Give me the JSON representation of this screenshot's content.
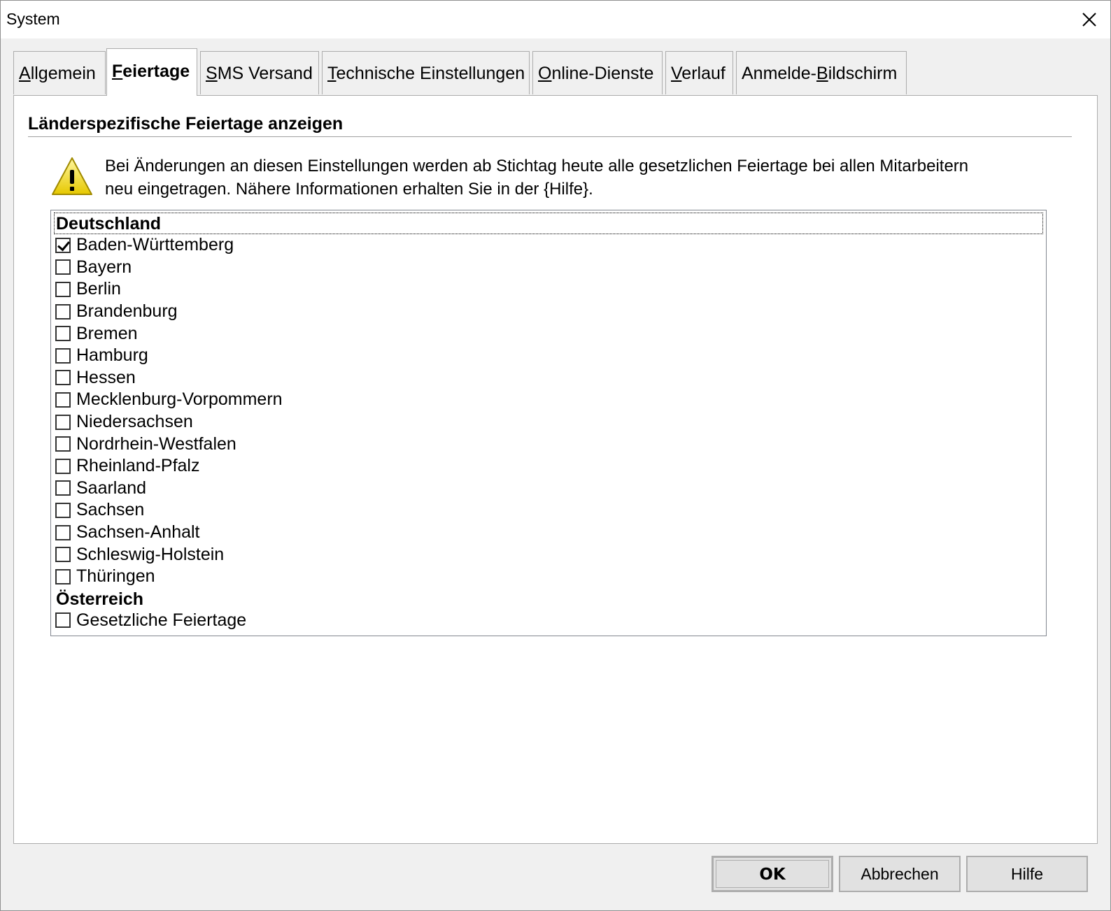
{
  "window": {
    "title": "System"
  },
  "tabs": [
    {
      "label": "Allgemein",
      "accel": "A",
      "rest": "llgemein",
      "active": false
    },
    {
      "label": "Feiertage",
      "accel": "F",
      "rest": "eiertage",
      "active": true
    },
    {
      "label": "SMS Versand",
      "accel": "S",
      "rest": "MS Versand",
      "active": false
    },
    {
      "label": "Technische Einstellungen",
      "accel": "T",
      "rest": "echnische Einstellungen",
      "active": false
    },
    {
      "label": "Online-Dienste",
      "accel": "O",
      "rest": "nline-Dienste",
      "active": false
    },
    {
      "label": "Verlauf",
      "accel": "V",
      "rest": "erlauf",
      "active": false
    },
    {
      "label": "Anmelde-Bildschirm",
      "pre": "Anmelde-",
      "accel": "B",
      "rest": "ildschirm",
      "active": false
    }
  ],
  "section": {
    "heading": "Länderspezifische Feiertage anzeigen",
    "warning_icon": "warning-icon",
    "warning_line1": "Bei Änderungen an diesen Einstellungen werden ab Stichtag heute alle gesetzlichen Feiertage bei allen Mitarbeitern",
    "warning_line2": "neu eingetragen. Nähere Informationen erhalten Sie in der {Hilfe}."
  },
  "list": {
    "groups": [
      {
        "name": "Deutschland",
        "items": [
          {
            "label": "Baden-Württemberg",
            "checked": true
          },
          {
            "label": "Bayern",
            "checked": false
          },
          {
            "label": "Berlin",
            "checked": false
          },
          {
            "label": "Brandenburg",
            "checked": false
          },
          {
            "label": "Bremen",
            "checked": false
          },
          {
            "label": "Hamburg",
            "checked": false
          },
          {
            "label": "Hessen",
            "checked": false
          },
          {
            "label": "Mecklenburg-Vorpommern",
            "checked": false
          },
          {
            "label": "Niedersachsen",
            "checked": false
          },
          {
            "label": "Nordrhein-Westfalen",
            "checked": false
          },
          {
            "label": "Rheinland-Pfalz",
            "checked": false
          },
          {
            "label": "Saarland",
            "checked": false
          },
          {
            "label": "Sachsen",
            "checked": false
          },
          {
            "label": "Sachsen-Anhalt",
            "checked": false
          },
          {
            "label": "Schleswig-Holstein",
            "checked": false
          },
          {
            "label": "Thüringen",
            "checked": false
          }
        ]
      },
      {
        "name": "Österreich",
        "items": [
          {
            "label": "Gesetzliche Feiertage",
            "checked": false
          }
        ]
      }
    ]
  },
  "buttons": {
    "ok": "OK",
    "cancel": "Abbrechen",
    "help": "Hilfe"
  }
}
